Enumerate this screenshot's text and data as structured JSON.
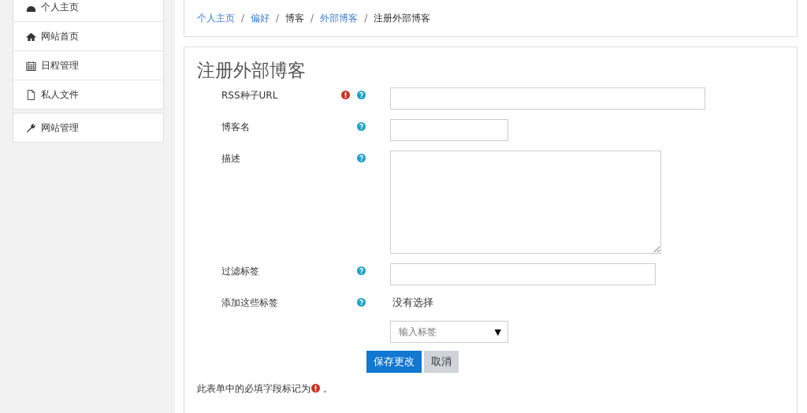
{
  "sidebar": {
    "items": [
      {
        "label": "个人主页"
      },
      {
        "label": "网站首页"
      },
      {
        "label": "日程管理"
      },
      {
        "label": "私人文件"
      }
    ],
    "admin_items": [
      {
        "label": "网站管理"
      }
    ]
  },
  "breadcrumb": [
    {
      "label": "个人主页",
      "link": true
    },
    {
      "separator": "/",
      "label": "偏好",
      "link": true
    },
    {
      "separator": "/",
      "label": "博客",
      "link": false
    },
    {
      "separator": "/",
      "label": "外部博客",
      "link": true
    },
    {
      "separator": "/",
      "label": "注册外部博客",
      "link": false
    }
  ],
  "form": {
    "title": "注册外部博客",
    "fields": [
      {
        "kind": "text",
        "label": "RSS种子URL",
        "required": true
      },
      {
        "kind": "text",
        "label": "博客名",
        "required": false
      },
      {
        "kind": "textarea",
        "label": "描述",
        "required": false
      },
      {
        "kind": "text",
        "label": "过滤标签",
        "required": false
      },
      {
        "kind": "tags",
        "label": "添加这些标签",
        "required": false,
        "status": "没有选择",
        "placeholder": "输入标签",
        "caret": "▼"
      }
    ],
    "buttons": [
      {
        "label": "保存更改",
        "primary": true
      },
      {
        "label": "取消",
        "primary": false
      }
    ],
    "note_before": "此表单中的必填字段标记为",
    "note_after": "。"
  }
}
